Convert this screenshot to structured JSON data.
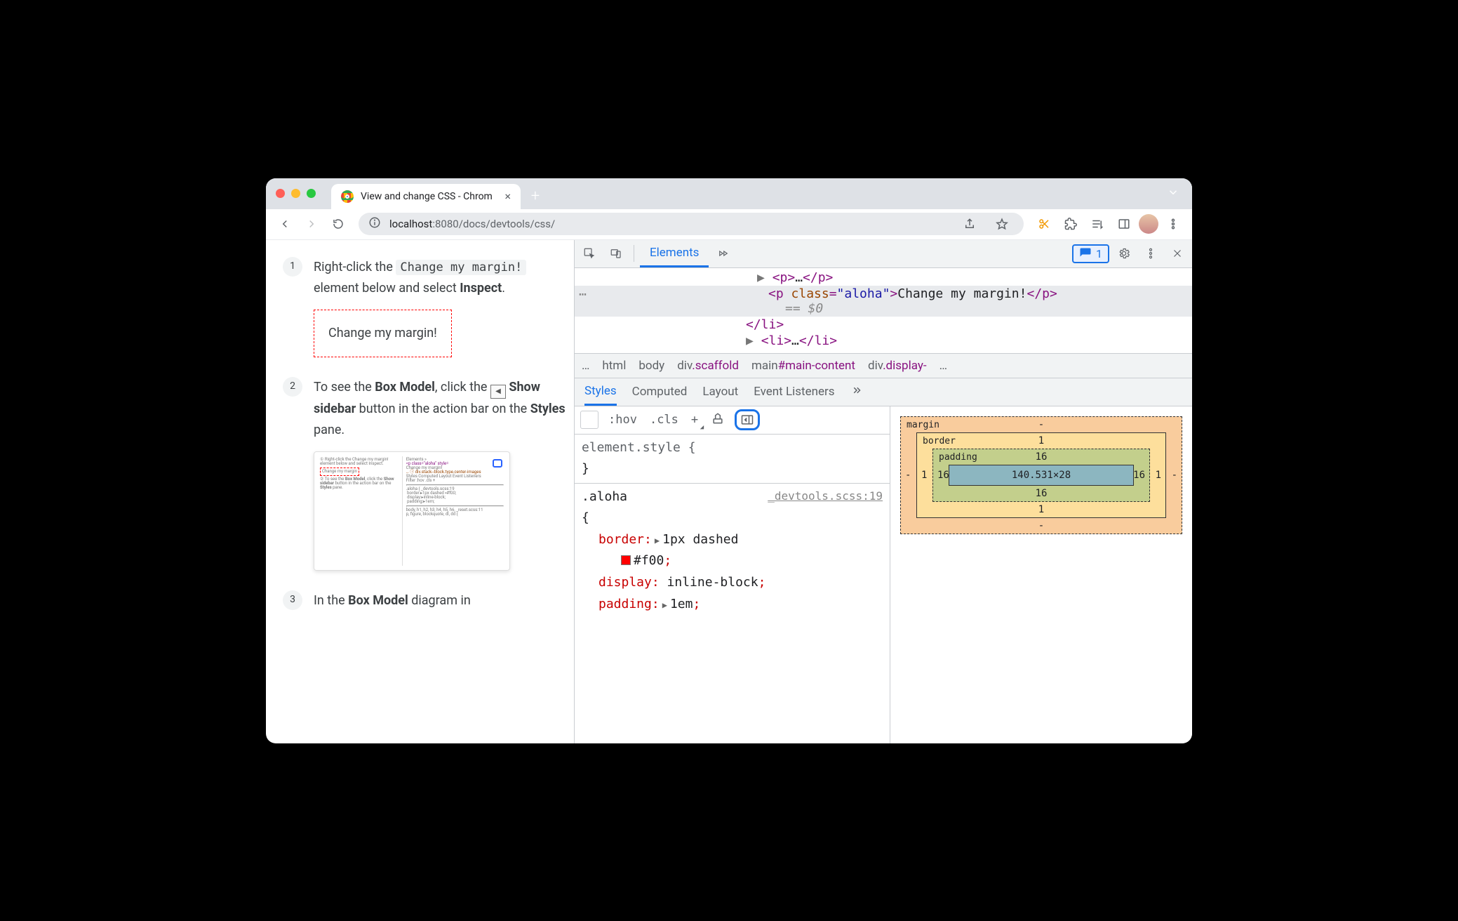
{
  "chrome": {
    "tab_title": "View and change CSS - Chrom",
    "url_host": "localhost",
    "url_port": ":8080",
    "url_path": "/docs/devtools/css/"
  },
  "docs": {
    "steps": [
      {
        "num": "1",
        "pre": "Right-click the ",
        "code": "Change my margin!",
        "mid": " element below and select ",
        "strong": "Inspect",
        "post": ".",
        "demo": "Change my margin!"
      },
      {
        "num": "2",
        "pre": "To see the ",
        "strong1": "Box Model",
        "mid1": ", click the ",
        "icon": "show-sidebar",
        "strong2": "Show sidebar",
        "mid2": " button in the action bar on the ",
        "strong3": "Styles",
        "post": " pane."
      },
      {
        "num": "3",
        "pre": "In the ",
        "strong": "Box Model",
        "post": " diagram in"
      }
    ]
  },
  "devtools": {
    "tabs": {
      "elements": "Elements"
    },
    "issues_count": "1",
    "dom": {
      "line1": "▶ <p>…</p>",
      "sel_open": "<p ",
      "sel_attr": "class",
      "sel_eq": "=",
      "sel_val": "\"aloha\"",
      "sel_close_open": ">",
      "sel_text": "Change my margin!",
      "sel_close": "</p>",
      "sel_note": " == $0",
      "line3": "</li>",
      "line4": "▶ <li>…</li>"
    },
    "breadcrumbs": [
      "…",
      "html",
      "body",
      "div.scaffold",
      "main#main-content",
      "div.display-",
      "…"
    ],
    "styles_tabs": [
      "Styles",
      "Computed",
      "Layout",
      "Event Listeners"
    ],
    "styles_toolbar": {
      "hov": ":hov",
      "cls": ".cls"
    },
    "css": {
      "element_style": "element.style {",
      "element_style_close": "}",
      "rule_sel": ".aloha",
      "rule_src": "_devtools.scss:19",
      "open": "{",
      "border_prop": "border",
      "border_val": "1px dashed",
      "border_color": "#f00",
      "display_prop": "display",
      "display_val": "inline-block",
      "padding_prop": "padding",
      "padding_val": "1em"
    },
    "boxmodel": {
      "margin_label": "margin",
      "border_label": "border",
      "padding_label": "padding",
      "margin": {
        "t": "-",
        "r": "-",
        "b": "-",
        "l": "-"
      },
      "border": {
        "t": "1",
        "r": "1",
        "b": "1",
        "l": "1"
      },
      "padding": {
        "t": "16",
        "r": "16",
        "b": "16",
        "l": "16"
      },
      "content": "140.531×28"
    }
  }
}
